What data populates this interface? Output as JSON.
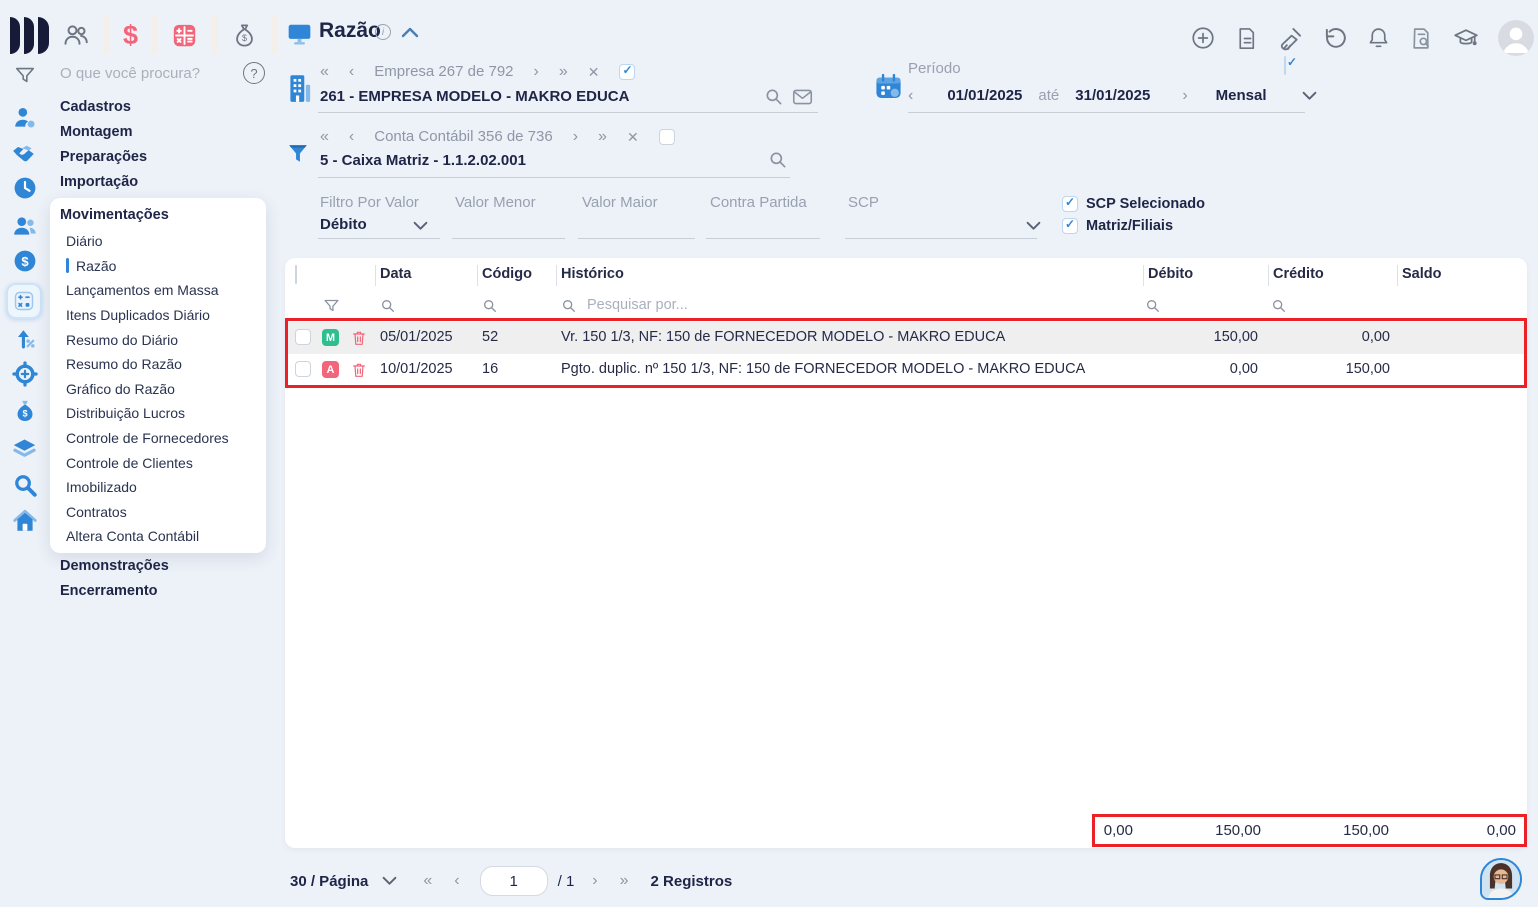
{
  "colors": {
    "accent_blue": "#2f86d6",
    "navy_text": "#1f2547",
    "annotation_red": "#ec2027",
    "badge_green": "#2fbf8f",
    "badge_red": "#f2657a",
    "row_highlight": "#efefef"
  },
  "icons": {
    "first_page": "«",
    "prev_page": "‹",
    "next_page": "›",
    "last_page": "»",
    "close": "✕",
    "help": "?",
    "info": "i",
    "dollar": "$"
  },
  "topbar": {
    "search_placeholder": "O que você procura?"
  },
  "sidebar": {
    "sections_top": [
      {
        "label": "Cadastros"
      },
      {
        "label": "Montagem"
      },
      {
        "label": "Preparações"
      },
      {
        "label": "Importação"
      }
    ],
    "submenu_title": "Movimentações",
    "submenu_items": [
      {
        "label": "Diário"
      },
      {
        "label": "Razão"
      },
      {
        "label": "Lançamentos em Massa"
      },
      {
        "label": "Itens Duplicados Diário"
      },
      {
        "label": "Resumo do Diário"
      },
      {
        "label": "Resumo do Razão"
      },
      {
        "label": "Gráfico do Razão"
      },
      {
        "label": "Distribuição Lucros"
      },
      {
        "label": "Controle de Fornecedores"
      },
      {
        "label": "Controle de Clientes"
      },
      {
        "label": "Imobilizado"
      },
      {
        "label": "Contratos"
      },
      {
        "label": "Altera Conta Contábil"
      }
    ],
    "sections_bottom": [
      {
        "label": "Demonstrações"
      },
      {
        "label": "Encerramento"
      }
    ]
  },
  "header": {
    "title": "Razão"
  },
  "company": {
    "nav_label": "Empresa 267 de 792",
    "value": "261 - EMPRESA MODELO - MAKRO EDUCA"
  },
  "account": {
    "nav_label": "Conta Contábil 356 de 736",
    "value": "5 - Caixa Matriz  - 1.1.2.02.001"
  },
  "period": {
    "label": "Período",
    "start_date": "01/01/2025",
    "until": "até",
    "end_date": "31/01/2025",
    "mode": "Mensal"
  },
  "filters": {
    "filter_by_value_label": "Filtro Por Valor",
    "filter_by_value": "Débito",
    "valor_menor_label": "Valor Menor",
    "valor_maior_label": "Valor Maior",
    "contra_partida_label": "Contra Partida",
    "scp_label": "SCP",
    "scp_selected_label": "SCP Selecionado",
    "matriz_filiais_label": "Matriz/Filiais"
  },
  "table": {
    "columns": {
      "data": "Data",
      "codigo": "Código",
      "historico": "Histórico",
      "debito": "Débito",
      "credito": "Crédito",
      "saldo": "Saldo"
    },
    "search_placeholder": "Pesquisar por...",
    "rows": [
      {
        "badge": "M",
        "data": "05/01/2025",
        "codigo": "52",
        "historico": "Vr. 150 1/3, NF: 150 de FORNECEDOR MODELO - MAKRO EDUCA",
        "debito": "150,00",
        "credito": "0,00",
        "saldo": ""
      },
      {
        "badge": "A",
        "data": "10/01/2025",
        "codigo": "16",
        "historico": "Pgto. duplic. nº 150 1/3, NF: 150 de FORNECEDOR MODELO - MAKRO EDUCA",
        "debito": "0,00",
        "credito": "150,00",
        "saldo": ""
      }
    ],
    "totals": {
      "saldo_anterior": "0,00",
      "debito": "150,00",
      "credito": "150,00",
      "saldo": "0,00"
    }
  },
  "pagination": {
    "page_size": "30 / Página",
    "page": "1",
    "of_pages": "/ 1",
    "records": "2 Registros"
  }
}
